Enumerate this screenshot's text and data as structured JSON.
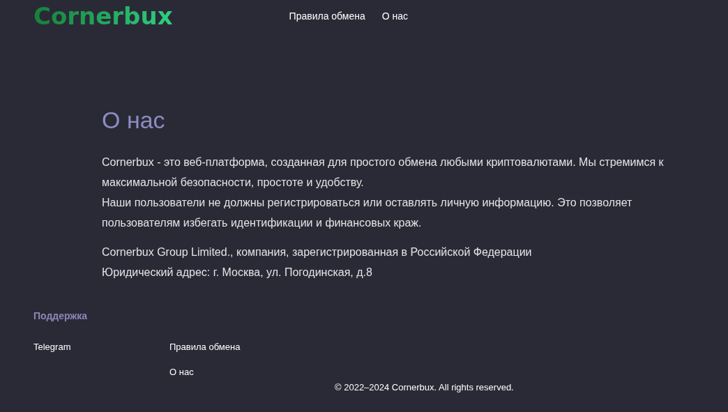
{
  "header": {
    "logo": "Cornerbux",
    "nav": [
      "Правила обмена",
      "О нас"
    ]
  },
  "content": {
    "title": "О нас",
    "paragraphs": [
      [
        "Cornerbux - это веб-платформа, созданная для простого обмена любыми криптовалютами. Мы стремимся к максимальной безопасности, простоте и удобству.",
        "Наши пользователи не должны регистрироваться или оставлять личную информацию. Это позволяет пользователям избегать идентификации и финансовых краж."
      ],
      [
        "Cornerbux Group Limited., компания, зарегистрированная в Российской Федерации",
        "Юридический адрес: г. Москва, ул. Погодинская, д.8"
      ]
    ]
  },
  "footer": {
    "heading": "Поддержка",
    "support_links": [
      "Telegram"
    ],
    "links": [
      "Правила обмена",
      "О нас"
    ],
    "copyright": "© 2022–2024 Cornerbux. All rights reserved."
  }
}
